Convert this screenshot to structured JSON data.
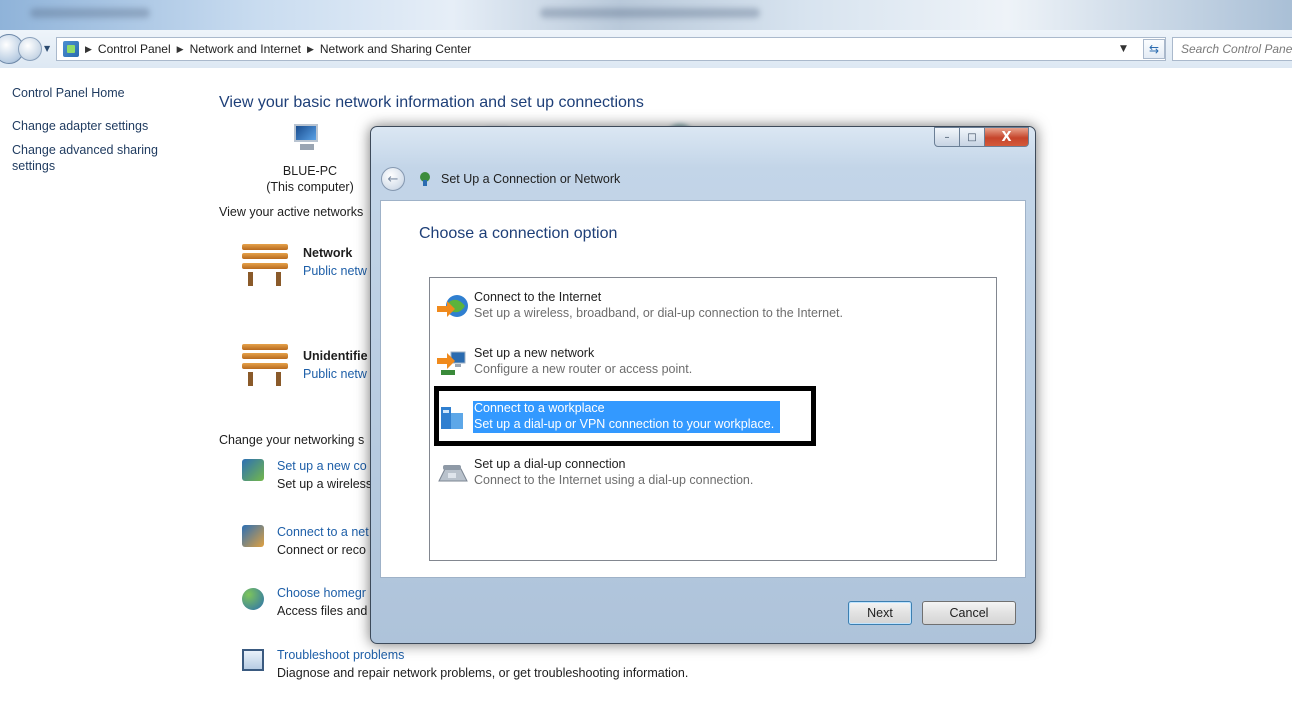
{
  "window": {
    "title_strip_blurred": true
  },
  "address_bar": {
    "crumbs": [
      "Control Panel",
      "Network and Internet",
      "Network and Sharing Center"
    ],
    "search_placeholder": "Search Control Panel"
  },
  "left_nav": {
    "home": "Control Panel Home",
    "links": [
      "Change adapter settings",
      "Change advanced sharing settings"
    ]
  },
  "main": {
    "title": "View your basic network information and set up connections",
    "computer_name": "BLUE-PC",
    "computer_sub": "(This computer)",
    "active_networks_label": "View your active networks",
    "networks": [
      {
        "name": "Network",
        "type": "Public netw"
      },
      {
        "name": "Unidentifie",
        "type": "Public netw"
      }
    ],
    "change_label": "Change your networking s",
    "tasks": [
      {
        "link": "Set up a new co",
        "desc": "Set up a wireless,",
        "icon": "network-setup-icon"
      },
      {
        "link": "Connect to a net",
        "desc": "Connect or reco",
        "icon": "connect-network-icon"
      },
      {
        "link": "Choose homegr",
        "desc": "Access files and",
        "icon": "homegroup-icon"
      },
      {
        "link": "Troubleshoot problems",
        "desc": "Diagnose and repair network problems, or get troubleshooting information.",
        "icon": "troubleshoot-icon"
      }
    ]
  },
  "dialog": {
    "title": "Set Up a Connection or Network",
    "heading": "Choose a connection option",
    "controls": {
      "minimize": "–",
      "maximize": "□",
      "close": "X"
    },
    "options": [
      {
        "title": "Connect to the Internet",
        "desc": "Set up a wireless, broadband, or dial-up connection to the Internet.",
        "icon": "globe-internet-icon",
        "selected": false
      },
      {
        "title": "Set up a new network",
        "desc": "Configure a new router or access point.",
        "icon": "new-network-icon",
        "selected": false
      },
      {
        "title": "Connect to a workplace",
        "desc": "Set up a dial-up or VPN connection to your workplace.",
        "icon": "workplace-icon",
        "selected": true
      },
      {
        "title": "Set up a dial-up connection",
        "desc": "Connect to the Internet using a dial-up connection.",
        "icon": "dialup-phone-icon",
        "selected": false
      }
    ],
    "buttons": {
      "next": "Next",
      "cancel": "Cancel"
    }
  },
  "colors": {
    "link": "#1e5fa8",
    "heading": "#1e3f78",
    "selection": "#3399ff",
    "annotation_frame": "#000000"
  }
}
